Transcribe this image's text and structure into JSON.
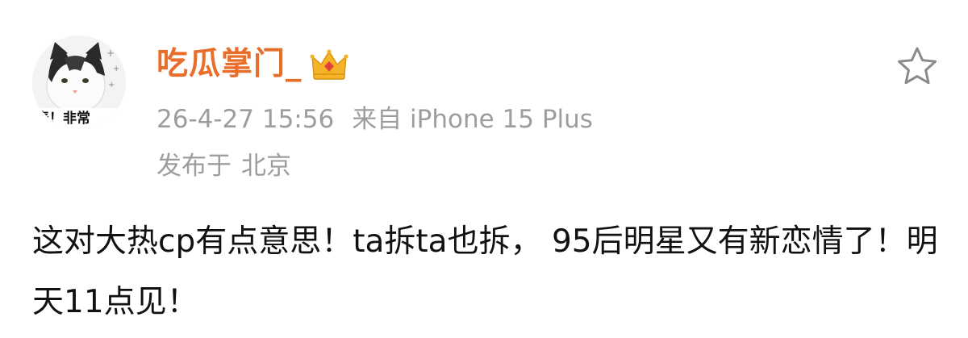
{
  "post": {
    "username": "吃瓜掌门_",
    "badge_icon": "crown-icon",
    "timestamp": "26-4-27 15:56",
    "source": "来自 iPhone 15 Plus",
    "location_prefix": "发布于",
    "location_name": "北京",
    "content": "这对大热cp有点意思！ta拆ta也拆， 95后明星又有新恋情了！明天11点见！",
    "avatar_caption": "表！非常"
  },
  "actions": {
    "favorite_icon": "star-icon"
  },
  "colors": {
    "username": "#e86e2c",
    "meta_text": "#9d9d9d",
    "body_text": "#111111",
    "crown_gold": "#f5b427",
    "crown_red": "#e0413a"
  }
}
